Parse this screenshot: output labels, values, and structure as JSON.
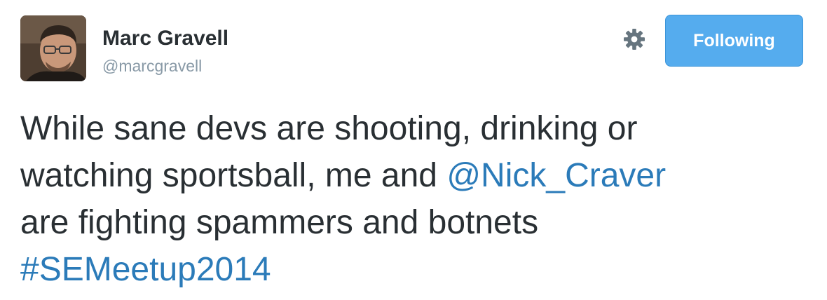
{
  "user": {
    "name": "Marc Gravell",
    "handle": "@marcgravell"
  },
  "actions": {
    "follow_label": "Following",
    "gear_icon": "gear-icon"
  },
  "colors": {
    "accent": "#55acee",
    "link": "#2b7bb9",
    "text": "#292f33",
    "muted": "#8899a6"
  },
  "tweet": {
    "line1": "While sane devs are shooting, drinking or",
    "line2_before": "watching sportsball, me and ",
    "mention": "@Nick_Craver",
    "line3": "are fighting spammers and botnets",
    "hashtag": "#SEMeetup2014"
  }
}
